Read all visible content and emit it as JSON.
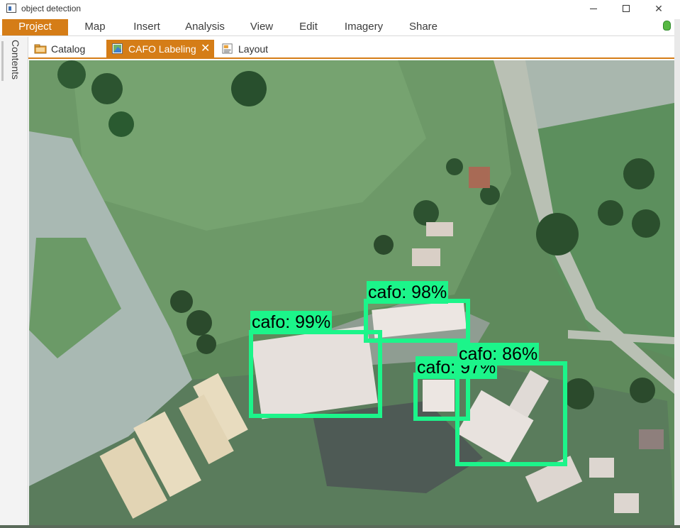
{
  "window": {
    "title": "object detection",
    "buttons": {
      "minimize": "—",
      "maximize": "☐",
      "close": "✕"
    }
  },
  "ribbon": {
    "tabs": [
      {
        "label": "Project",
        "active": true
      },
      {
        "label": "Map"
      },
      {
        "label": "Insert"
      },
      {
        "label": "Analysis"
      },
      {
        "label": "View"
      },
      {
        "label": "Edit"
      },
      {
        "label": "Imagery"
      },
      {
        "label": "Share"
      }
    ],
    "accent_color": "#d57d17",
    "status_icon": "bug-icon"
  },
  "sidepanel": {
    "contents_label": "Contents"
  },
  "doc_tabs": [
    {
      "label": "Catalog",
      "icon": "catalog-folder-icon"
    },
    {
      "label": "CAFO Labeling",
      "icon": "map-icon",
      "active": true,
      "close": "✕"
    },
    {
      "label": "Layout",
      "icon": "layout-page-icon"
    }
  ],
  "detections": {
    "color": "#1cf58a",
    "items": [
      {
        "label": "cafo: 99%"
      },
      {
        "label": "cafo: 98%"
      },
      {
        "label": "cafo: 97%"
      },
      {
        "label": "cafo: 86%"
      }
    ]
  }
}
